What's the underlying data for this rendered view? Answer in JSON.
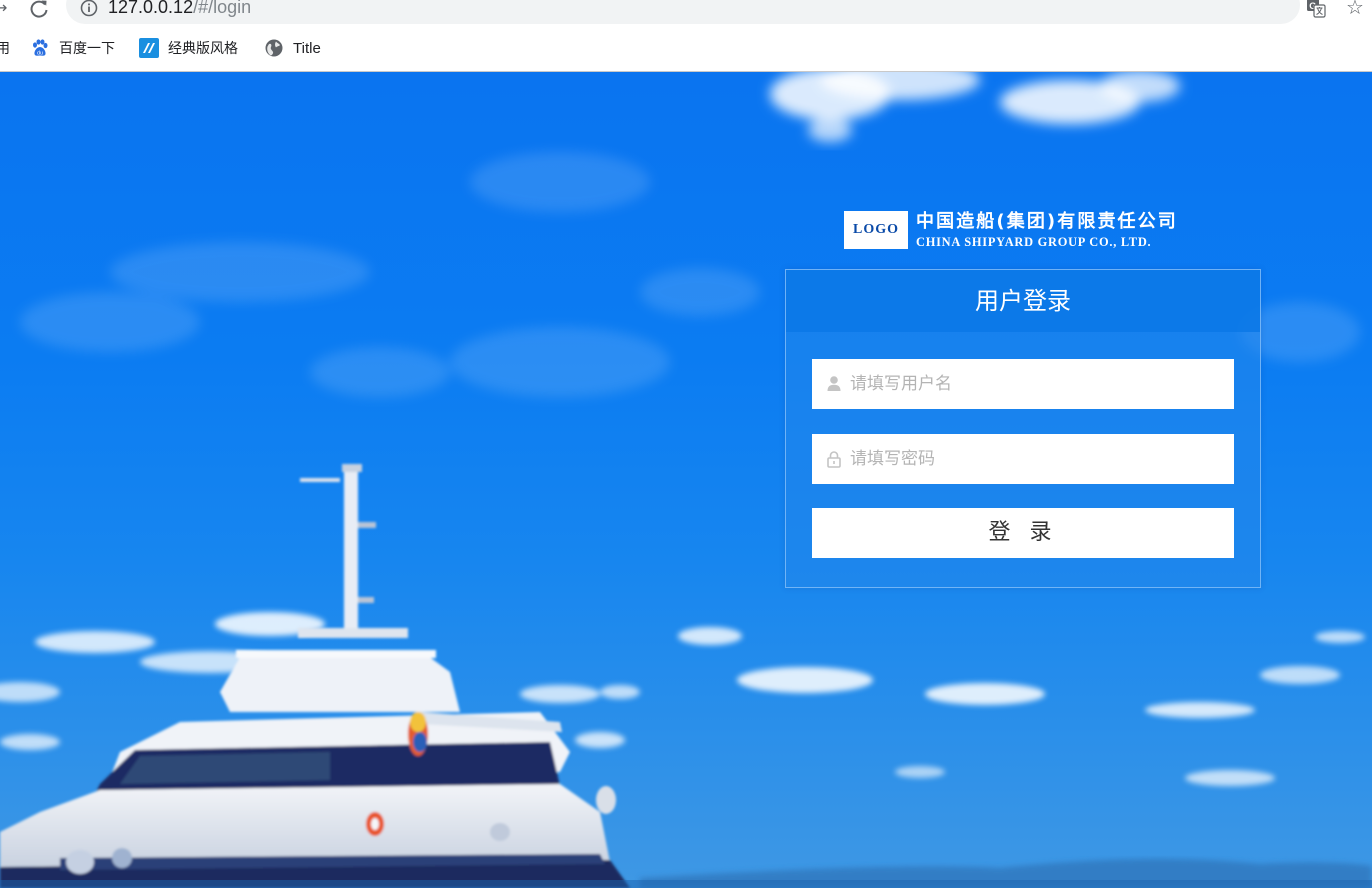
{
  "browser": {
    "url_host": "127.0.0.12",
    "url_path": "/#/login",
    "bookmarks": [
      {
        "label": "用",
        "icon": "apps-icon"
      },
      {
        "label": "百度一下",
        "icon": "baidu-paw-icon"
      },
      {
        "label": "经典版风格",
        "icon": "classic-style-icon"
      },
      {
        "label": "Title",
        "icon": "globe-icon"
      }
    ]
  },
  "brand": {
    "logo_text": "LOGO",
    "name_cn": "中国造船(集团)有限责任公司",
    "name_en": "CHINA SHIPYARD GROUP CO., LTD."
  },
  "login": {
    "title": "用户登录",
    "username_placeholder": "请填写用户名",
    "username_value": "",
    "password_placeholder": "请填写密码",
    "password_value": "",
    "submit_label": "登 录"
  },
  "colors": {
    "sky_blue": "#0b7cf2",
    "panel_header": "#0a78e6",
    "white": "#ffffff",
    "placeholder_gray": "#b4b4b4"
  }
}
